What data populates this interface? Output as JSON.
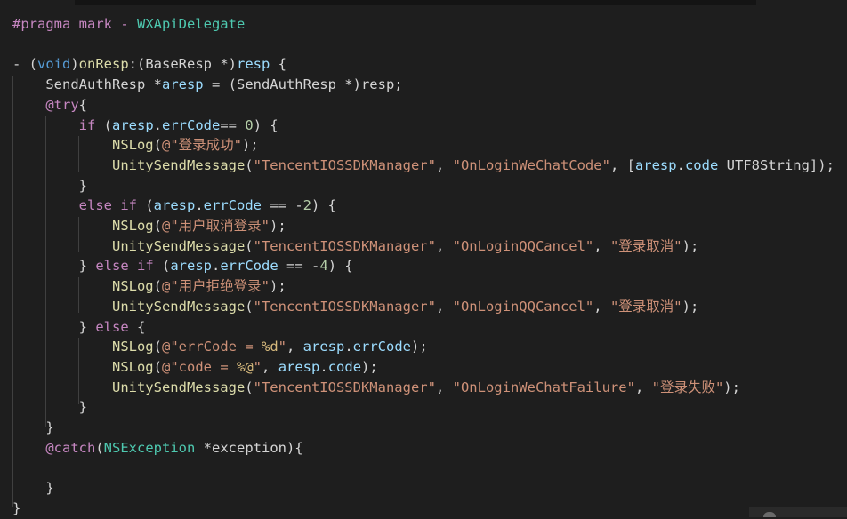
{
  "editor": {
    "lines": [
      {
        "tokens": [
          [
            "mac",
            "#pragma mark - "
          ],
          [
            "type",
            "WXApiDelegate"
          ]
        ]
      },
      {
        "tokens": []
      },
      {
        "tokens": [
          [
            "pl",
            "- ("
          ],
          [
            "kw",
            "void"
          ],
          [
            "pl",
            ")"
          ],
          [
            "fn",
            "onResp"
          ],
          [
            "pl",
            ":("
          ],
          [
            "pl",
            "BaseResp *"
          ],
          [
            "pl",
            ")"
          ],
          [
            "var",
            "resp"
          ],
          [
            "pl",
            " {"
          ]
        ]
      },
      {
        "tokens": [
          [
            "pl",
            "    SendAuthResp *"
          ],
          [
            "var",
            "aresp"
          ],
          [
            "pl",
            " = (SendAuthResp *)resp;"
          ]
        ]
      },
      {
        "tokens": [
          [
            "pl",
            "    "
          ],
          [
            "kw2",
            "@try"
          ],
          [
            "pl",
            "{"
          ]
        ]
      },
      {
        "tokens": [
          [
            "pl",
            "        "
          ],
          [
            "kw2",
            "if"
          ],
          [
            "pl",
            " ("
          ],
          [
            "var",
            "aresp"
          ],
          [
            "pl",
            "."
          ],
          [
            "var",
            "errCode"
          ],
          [
            "pl",
            "== "
          ],
          [
            "num",
            "0"
          ],
          [
            "pl",
            ") {"
          ]
        ]
      },
      {
        "tokens": [
          [
            "pl",
            "            "
          ],
          [
            "fn",
            "NSLog"
          ],
          [
            "pl",
            "("
          ],
          [
            "str",
            "@\"登录成功\""
          ],
          [
            "pl",
            ");"
          ]
        ]
      },
      {
        "tokens": [
          [
            "pl",
            "            "
          ],
          [
            "fn",
            "UnitySendMessage"
          ],
          [
            "pl",
            "("
          ],
          [
            "str",
            "\"TencentIOSSDKManager\""
          ],
          [
            "pl",
            ", "
          ],
          [
            "str",
            "\"OnLoginWeChatCode\""
          ],
          [
            "pl",
            ", ["
          ],
          [
            "var",
            "aresp"
          ],
          [
            "pl",
            "."
          ],
          [
            "var",
            "code"
          ],
          [
            "pl",
            " UTF8String]);"
          ]
        ]
      },
      {
        "tokens": [
          [
            "pl",
            "        }"
          ]
        ]
      },
      {
        "tokens": [
          [
            "pl",
            "        "
          ],
          [
            "kw2",
            "else if"
          ],
          [
            "pl",
            " ("
          ],
          [
            "var",
            "aresp"
          ],
          [
            "pl",
            "."
          ],
          [
            "var",
            "errCode"
          ],
          [
            "pl",
            " == -"
          ],
          [
            "num",
            "2"
          ],
          [
            "pl",
            ") {"
          ]
        ]
      },
      {
        "tokens": [
          [
            "pl",
            "            "
          ],
          [
            "fn",
            "NSLog"
          ],
          [
            "pl",
            "("
          ],
          [
            "str",
            "@\"用户取消登录\""
          ],
          [
            "pl",
            ");"
          ]
        ]
      },
      {
        "tokens": [
          [
            "pl",
            "            "
          ],
          [
            "fn",
            "UnitySendMessage"
          ],
          [
            "pl",
            "("
          ],
          [
            "str",
            "\"TencentIOSSDKManager\""
          ],
          [
            "pl",
            ", "
          ],
          [
            "str",
            "\"OnLoginQQCancel\""
          ],
          [
            "pl",
            ", "
          ],
          [
            "str",
            "\"登录取消\""
          ],
          [
            "pl",
            ");"
          ]
        ]
      },
      {
        "tokens": [
          [
            "pl",
            "        } "
          ],
          [
            "kw2",
            "else if"
          ],
          [
            "pl",
            " ("
          ],
          [
            "var",
            "aresp"
          ],
          [
            "pl",
            "."
          ],
          [
            "var",
            "errCode"
          ],
          [
            "pl",
            " == -"
          ],
          [
            "num",
            "4"
          ],
          [
            "pl",
            ") {"
          ]
        ]
      },
      {
        "tokens": [
          [
            "pl",
            "            "
          ],
          [
            "fn",
            "NSLog"
          ],
          [
            "pl",
            "("
          ],
          [
            "str",
            "@\"用户拒绝登录\""
          ],
          [
            "pl",
            ");"
          ]
        ]
      },
      {
        "tokens": [
          [
            "pl",
            "            "
          ],
          [
            "fn",
            "UnitySendMessage"
          ],
          [
            "pl",
            "("
          ],
          [
            "str",
            "\"TencentIOSSDKManager\""
          ],
          [
            "pl",
            ", "
          ],
          [
            "str",
            "\"OnLoginQQCancel\""
          ],
          [
            "pl",
            ", "
          ],
          [
            "str",
            "\"登录取消\""
          ],
          [
            "pl",
            ");"
          ]
        ]
      },
      {
        "tokens": [
          [
            "pl",
            "        } "
          ],
          [
            "kw2",
            "else"
          ],
          [
            "pl",
            " {"
          ]
        ]
      },
      {
        "tokens": [
          [
            "pl",
            "            "
          ],
          [
            "fn",
            "NSLog"
          ],
          [
            "pl",
            "("
          ],
          [
            "str",
            "@\"errCode = "
          ],
          [
            "fmt",
            "%d"
          ],
          [
            "str",
            "\""
          ],
          [
            "pl",
            ", "
          ],
          [
            "var",
            "aresp"
          ],
          [
            "pl",
            "."
          ],
          [
            "var",
            "errCode"
          ],
          [
            "pl",
            ");"
          ]
        ]
      },
      {
        "tokens": [
          [
            "pl",
            "            "
          ],
          [
            "fn",
            "NSLog"
          ],
          [
            "pl",
            "("
          ],
          [
            "str",
            "@\"code = "
          ],
          [
            "fmt",
            "%@"
          ],
          [
            "str",
            "\""
          ],
          [
            "pl",
            ", "
          ],
          [
            "var",
            "aresp"
          ],
          [
            "pl",
            "."
          ],
          [
            "var",
            "code"
          ],
          [
            "pl",
            ");"
          ]
        ]
      },
      {
        "tokens": [
          [
            "pl",
            "            "
          ],
          [
            "fn",
            "UnitySendMessage"
          ],
          [
            "pl",
            "("
          ],
          [
            "str",
            "\"TencentIOSSDKManager\""
          ],
          [
            "pl",
            ", "
          ],
          [
            "str",
            "\"OnLoginWeChatFailure\""
          ],
          [
            "pl",
            ", "
          ],
          [
            "str",
            "\"登录失败\""
          ],
          [
            "pl",
            ");"
          ]
        ]
      },
      {
        "tokens": [
          [
            "pl",
            "        }"
          ]
        ]
      },
      {
        "tokens": [
          [
            "pl",
            "    }"
          ]
        ]
      },
      {
        "tokens": [
          [
            "pl",
            "    "
          ],
          [
            "kw2",
            "@catch"
          ],
          [
            "pl",
            "("
          ],
          [
            "type",
            "NSException"
          ],
          [
            "pl",
            " *exception){"
          ]
        ]
      },
      {
        "tokens": []
      },
      {
        "tokens": [
          [
            "pl",
            "    }"
          ]
        ]
      },
      {
        "tokens": [
          [
            "pl",
            "}"
          ]
        ]
      }
    ]
  }
}
